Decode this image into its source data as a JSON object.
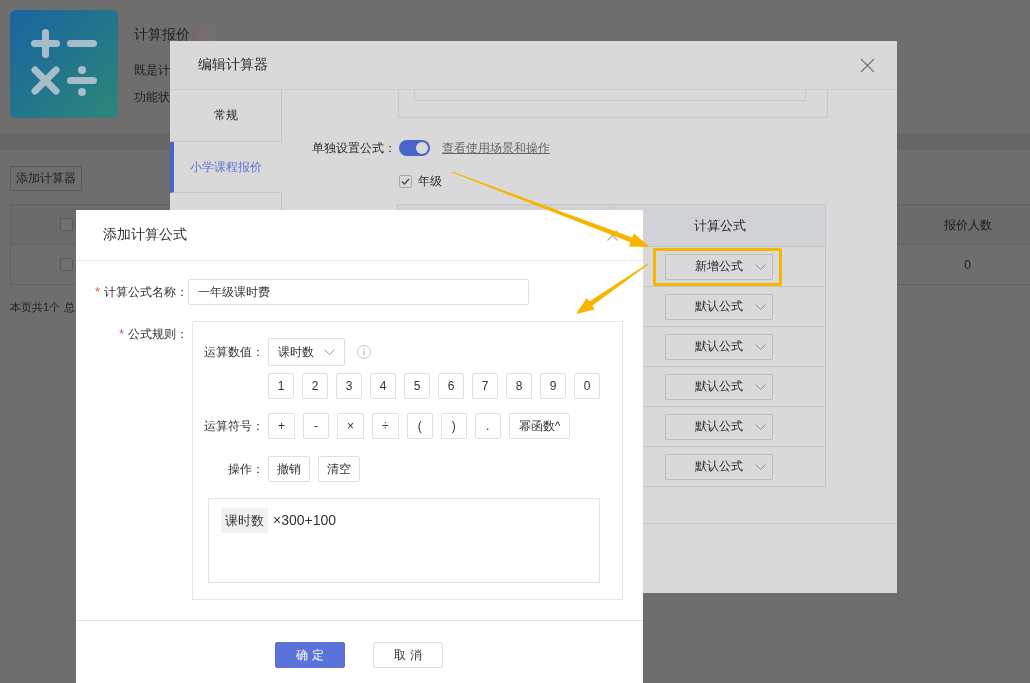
{
  "page": {
    "title": "计算报价",
    "description": "既是计",
    "status": "功能状",
    "add_button": "添加计算器",
    "table": {
      "header_checked": false,
      "count_heading": "报价人数",
      "rows": [
        {
          "checked": false,
          "count": "0"
        }
      ]
    },
    "summary": [
      "本页共1个",
      "总"
    ]
  },
  "edit_dialog": {
    "title": "编辑计算器",
    "tabs": [
      {
        "label": "常规",
        "selected": false
      },
      {
        "label": "小学课程报价",
        "selected": true
      }
    ],
    "separate_formula": {
      "label": "单独设置公式：",
      "on": true,
      "link": "查看使用场景和操作"
    },
    "grade": {
      "label": "年级",
      "checked": true
    },
    "table": {
      "column_2": "计算公式",
      "rows": [
        {
          "formula": "新增公式",
          "highlighted": true
        },
        {
          "formula": "默认公式",
          "highlighted": false
        },
        {
          "formula": "默认公式",
          "highlighted": false
        },
        {
          "formula": "默认公式",
          "highlighted": false
        },
        {
          "formula": "默认公式",
          "highlighted": false
        },
        {
          "formula": "默认公式",
          "highlighted": false
        }
      ]
    }
  },
  "add_dialog": {
    "title": "添加计算公式",
    "name": {
      "mark": "*",
      "label": "计算公式名称：",
      "value": "一年级课时费"
    },
    "rule": {
      "mark": "*",
      "label": "公式规则：",
      "operand_label": "运算数值：",
      "operand": "课时数",
      "digits": [
        "1",
        "2",
        "3",
        "4",
        "5",
        "6",
        "7",
        "8",
        "9",
        "0"
      ],
      "operator_label": "运算符号：",
      "operators": [
        "+",
        "-",
        "×",
        "÷",
        "(",
        ")",
        ".",
        "幂函数^"
      ],
      "action_label": "操作：",
      "actions": [
        "撤销",
        "清空"
      ],
      "formula": [
        {
          "kind": "variable",
          "text": "课时数"
        },
        {
          "kind": "text",
          "text": "×300+100"
        }
      ]
    },
    "buttons": [
      {
        "label": "确 定",
        "primary": true
      },
      {
        "label": "取 消",
        "primary": false
      }
    ]
  }
}
